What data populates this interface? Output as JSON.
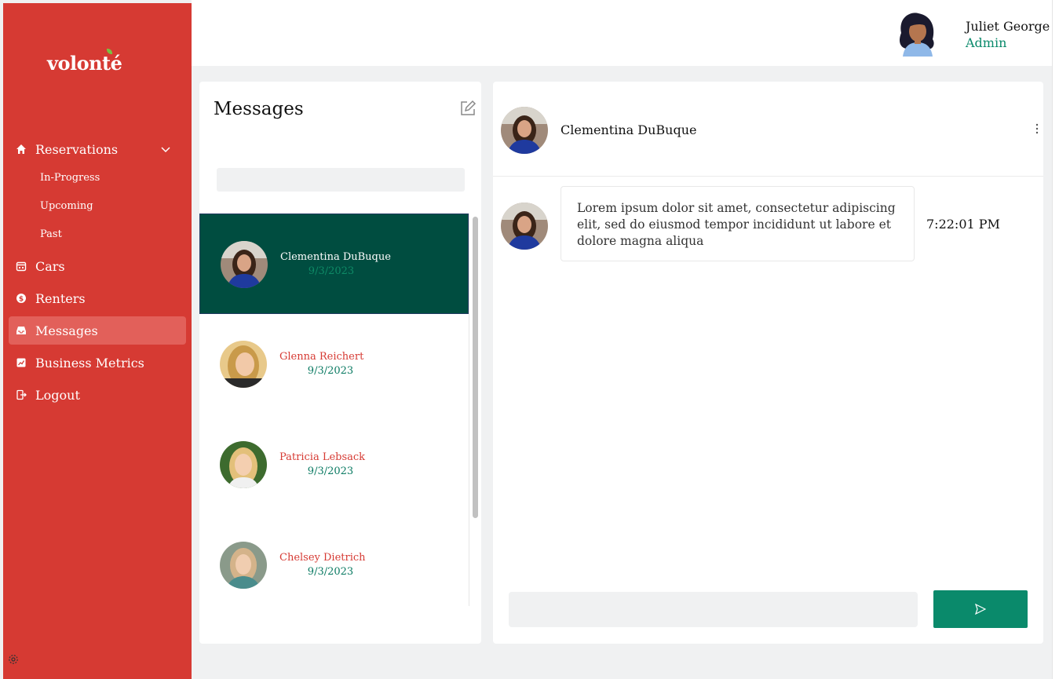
{
  "brand": {
    "logo_text": "volonté",
    "primary_color": "#d63a33",
    "accent_color": "#0a8a6b",
    "active_conversation_color": "#004d40"
  },
  "sidebar": {
    "items": [
      {
        "label": "Reservations",
        "icon": "home-icon",
        "expanded": true,
        "children": [
          {
            "label": "In-Progress"
          },
          {
            "label": "Upcoming"
          },
          {
            "label": "Past"
          }
        ]
      },
      {
        "label": "Cars",
        "icon": "calendar-icon"
      },
      {
        "label": "Renters",
        "icon": "dollar-circle-icon"
      },
      {
        "label": "Messages",
        "icon": "inbox-icon",
        "active": true
      },
      {
        "label": "Business Metrics",
        "icon": "chart-icon"
      },
      {
        "label": "Logout",
        "icon": "logout-icon"
      }
    ],
    "footer_icon": "settings-icon"
  },
  "user": {
    "name": "Juliet George",
    "role": "Admin",
    "avatar_icon": "user-avatar"
  },
  "messages_panel": {
    "title": "Messages",
    "compose_icon": "edit-icon",
    "search": {
      "value": "",
      "placeholder": ""
    },
    "conversations": [
      {
        "name": "Clementina DuBuque",
        "date": "9/3/2023",
        "active": true
      },
      {
        "name": "Glenna Reichert",
        "date": "9/3/2023"
      },
      {
        "name": "Patricia Lebsack",
        "date": "9/3/2023"
      },
      {
        "name": "Chelsey Dietrich",
        "date": "9/3/2023"
      }
    ]
  },
  "chat": {
    "contact_name": "Clementina DuBuque",
    "menu_icon": "more-vertical-icon",
    "messages": [
      {
        "text": "Lorem ipsum dolor sit amet, consectetur adipiscing elit, sed do eiusmod tempor incididunt ut labore et dolore magna aliqua",
        "time": "7:22:01 PM"
      }
    ],
    "composer": {
      "value": "",
      "placeholder": ""
    },
    "send_icon": "send-icon"
  }
}
